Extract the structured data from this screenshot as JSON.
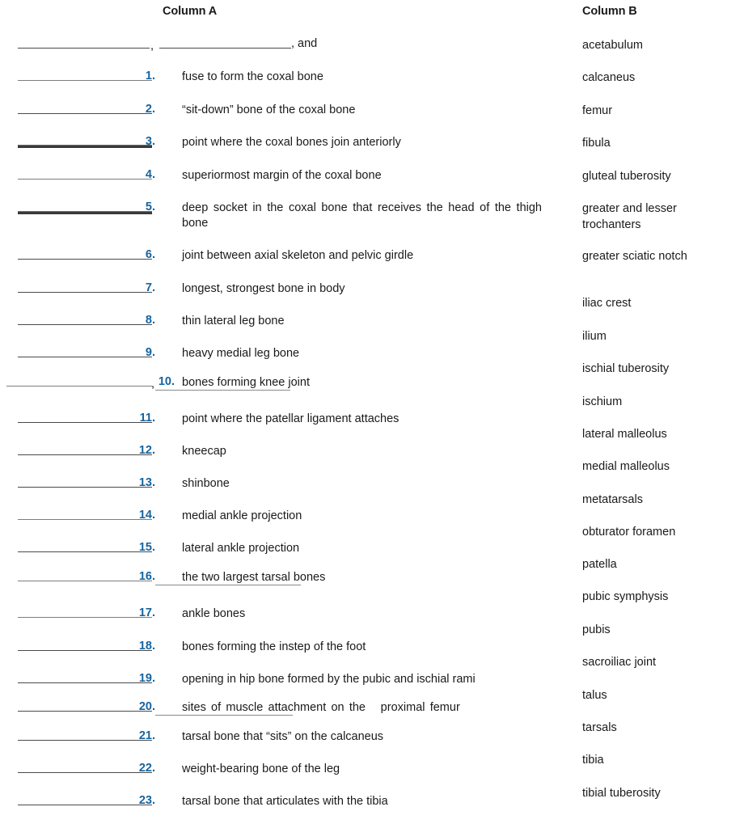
{
  "headers": {
    "column_a": "Column A",
    "column_b": "Column B"
  },
  "column_a": {
    "intro_row": {
      "trailing_text": ", and",
      "separator": ","
    },
    "items": [
      {
        "number": "1.",
        "text": "fuse to form the coxal bone"
      },
      {
        "number": "2.",
        "text": "“sit-down” bone of the coxal bone"
      },
      {
        "number": "3.",
        "text": "point where the coxal bones join anteriorly"
      },
      {
        "number": "4.",
        "text": "superiormost margin of the coxal bone"
      },
      {
        "number": "5.",
        "text": "deep socket in the coxal bone that receives the head of the thigh bone"
      },
      {
        "number": "6.",
        "text": "joint between axial skeleton and pelvic girdle"
      },
      {
        "number": "7.",
        "text": "longest, strongest bone in body"
      },
      {
        "number": "8.",
        "text": "thin lateral leg bone"
      },
      {
        "number": "9.",
        "text": "heavy medial leg bone"
      },
      {
        "number": "10.",
        "text": "bones forming knee joint"
      },
      {
        "number": "11.",
        "text": "point where the patellar ligament attaches"
      },
      {
        "number": "12.",
        "text": "kneecap"
      },
      {
        "number": "13.",
        "text": "shinbone"
      },
      {
        "number": "14.",
        "text": "medial ankle projection"
      },
      {
        "number": "15.",
        "text": "lateral ankle projection"
      },
      {
        "number": "16.",
        "text": "the two largest tarsal bones"
      },
      {
        "number": "17.",
        "text": "ankle bones"
      },
      {
        "number": "18.",
        "text": "bones forming the instep of the foot"
      },
      {
        "number": "19.",
        "text": "opening in hip bone formed by the pubic and ischial rami"
      },
      {
        "number": "20.",
        "text": "sites of muscle attachment on the   proximal femur"
      },
      {
        "number": "21.",
        "text": "tarsal bone that “sits” on the calcaneus"
      },
      {
        "number": "22.",
        "text": "weight-bearing bone of the leg"
      },
      {
        "number": "23.",
        "text": "tarsal bone that articulates with the tibia"
      }
    ]
  },
  "column_b": {
    "terms": [
      "acetabulum",
      "calcaneus",
      "femur",
      "fibula",
      "gluteal tuberosity",
      "greater and lesser trochanters",
      "greater sciatic notch",
      "iliac crest",
      "ilium",
      "ischial tuberosity",
      "ischium",
      "lateral malleolus",
      "medial malleolus",
      "metatarsals",
      "obturator foramen",
      "patella",
      "pubic symphysis",
      "pubis",
      "sacroiliac joint",
      "talus",
      "tarsals",
      "tibia",
      "tibial tuberosity"
    ]
  },
  "colors": {
    "number_blue": "#1464a0",
    "text_black": "#1a1a1a",
    "rule_gray": "#4a4a4a"
  }
}
